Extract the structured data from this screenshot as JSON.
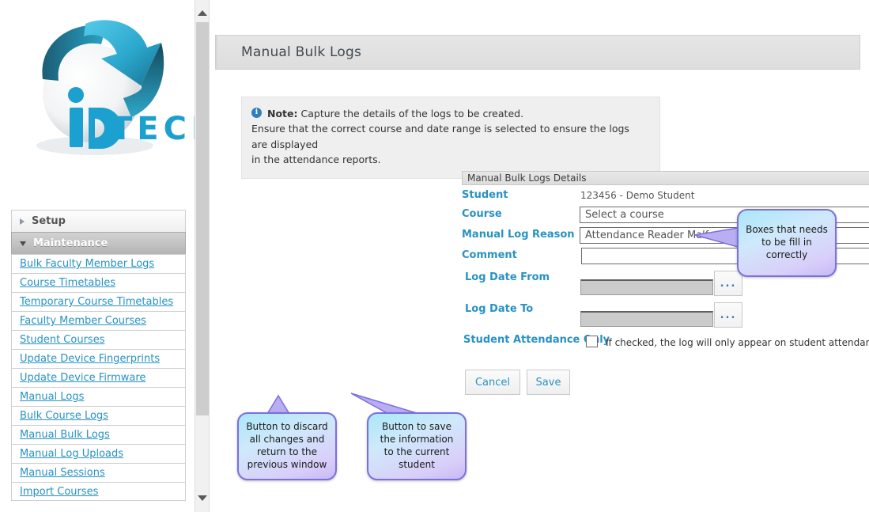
{
  "logo": {
    "brand_text": "TECH",
    "brand_mark": "ip",
    "colors": {
      "cyan": "#33b5d8",
      "dark_teal": "#1d6b80",
      "deep": "#14485c"
    }
  },
  "sidebar": {
    "groups": [
      {
        "label": "Setup",
        "expanded": false,
        "icon": "triangle-right-icon"
      },
      {
        "label": "Maintenance",
        "expanded": true,
        "icon": "triangle-down-icon"
      }
    ],
    "links": [
      "Bulk Faculty Member Logs",
      "Course Timetables",
      "Temporary Course Timetables",
      "Faculty Member Courses",
      "Student Courses",
      "Update Device Fingerprints",
      "Update Device Firmware",
      "Manual Logs",
      "Bulk Course Logs",
      "Manual Bulk Logs",
      "Manual Log Uploads",
      "Manual Sessions",
      "Import Courses"
    ],
    "link_color": "#2892c4"
  },
  "scrollbar": {
    "up_icon": "chevron-up-icon",
    "down_icon": "chevron-down-icon"
  },
  "header": {
    "title": "Manual Bulk Logs"
  },
  "note": {
    "icon": "info-icon",
    "label": "Note:",
    "line1": "Capture the details of the logs to be created.",
    "line2": "Ensure that the correct course and date range is selected to ensure the logs are displayed",
    "line3": "in the attendance reports."
  },
  "form": {
    "section_title": "Manual Bulk Logs Details",
    "student": {
      "label": "Student",
      "value": "123456 - Demo Student"
    },
    "course": {
      "label": "Course",
      "value": "Select a course",
      "icon": "chevron-down-icon"
    },
    "manual_log_reason": {
      "label": "Manual Log Reason",
      "value": "Attendance Reader Malfunction",
      "icon": "chevron-down-icon"
    },
    "comment": {
      "label": "Comment",
      "value": ""
    },
    "log_date_from": {
      "label": "Log Date From",
      "value": "",
      "picker": "..."
    },
    "log_date_to": {
      "label": "Log Date To",
      "value": "",
      "picker": "..."
    },
    "student_attendance_only": {
      "label": "Student Attendance Only",
      "checked": false,
      "hint": "If checked, the log will only appear on student attendance reports; otherwise, it will appear on all attendance reports."
    }
  },
  "buttons": {
    "cancel": "Cancel",
    "save": "Save"
  },
  "callouts": {
    "fields": "Boxes that needs to be fill in correctly",
    "cancel": "Button to discard all changes and return to the previous window",
    "save": "Button to save the information to the current student"
  }
}
